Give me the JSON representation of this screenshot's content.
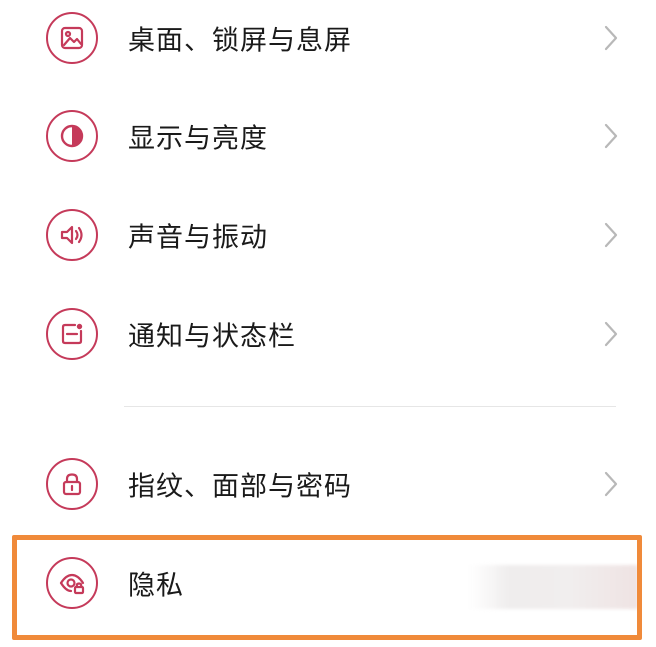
{
  "accent_color": "#c53a5a",
  "highlight_color": "#f08a3a",
  "settings": {
    "items": [
      {
        "label": "桌面、锁屏与息屏",
        "icon": "wallpaper-icon"
      },
      {
        "label": "显示与亮度",
        "icon": "brightness-icon"
      },
      {
        "label": "声音与振动",
        "icon": "speaker-icon"
      },
      {
        "label": "通知与状态栏",
        "icon": "notification-icon"
      },
      {
        "label": "指纹、面部与密码",
        "icon": "lock-icon"
      },
      {
        "label": "隐私",
        "icon": "privacy-eye-icon"
      }
    ]
  }
}
